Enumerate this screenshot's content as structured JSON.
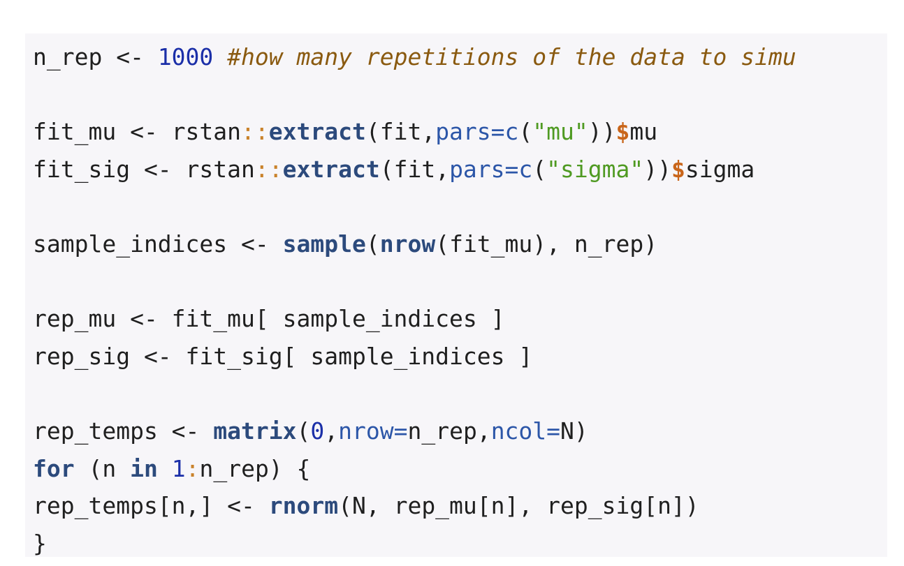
{
  "code": {
    "lines": [
      [
        {
          "text": "n_rep <- ",
          "kind": "plain"
        },
        {
          "text": "1000",
          "kind": "num"
        },
        {
          "text": " ",
          "kind": "plain"
        },
        {
          "text": "#how many repetitions of the data to simu",
          "kind": "comment"
        }
      ],
      [],
      [
        {
          "text": "fit_mu <- rstan",
          "kind": "plain"
        },
        {
          "text": "::",
          "kind": "op"
        },
        {
          "text": "extract",
          "kind": "fn"
        },
        {
          "text": "(fit,",
          "kind": "plain"
        },
        {
          "text": "pars=",
          "kind": "arg"
        },
        {
          "text": "c",
          "kind": "arg"
        },
        {
          "text": "(",
          "kind": "plain"
        },
        {
          "text": "\"mu\"",
          "kind": "str"
        },
        {
          "text": "))",
          "kind": "plain"
        },
        {
          "text": "$",
          "kind": "dollar"
        },
        {
          "text": "mu",
          "kind": "plain"
        }
      ],
      [
        {
          "text": "fit_sig <- rstan",
          "kind": "plain"
        },
        {
          "text": "::",
          "kind": "op"
        },
        {
          "text": "extract",
          "kind": "fn"
        },
        {
          "text": "(fit,",
          "kind": "plain"
        },
        {
          "text": "pars=",
          "kind": "arg"
        },
        {
          "text": "c",
          "kind": "arg"
        },
        {
          "text": "(",
          "kind": "plain"
        },
        {
          "text": "\"sigma\"",
          "kind": "str"
        },
        {
          "text": "))",
          "kind": "plain"
        },
        {
          "text": "$",
          "kind": "dollar"
        },
        {
          "text": "sigma",
          "kind": "plain"
        }
      ],
      [],
      [
        {
          "text": "sample_indices <- ",
          "kind": "plain"
        },
        {
          "text": "sample",
          "kind": "fn"
        },
        {
          "text": "(",
          "kind": "plain"
        },
        {
          "text": "nrow",
          "kind": "fn"
        },
        {
          "text": "(fit_mu), n_rep)",
          "kind": "plain"
        }
      ],
      [],
      [
        {
          "text": "rep_mu <- fit_mu[ sample_indices ]",
          "kind": "plain"
        }
      ],
      [
        {
          "text": "rep_sig <- fit_sig[ sample_indices ]",
          "kind": "plain"
        }
      ],
      [],
      [
        {
          "text": "rep_temps <- ",
          "kind": "plain"
        },
        {
          "text": "matrix",
          "kind": "fn"
        },
        {
          "text": "(",
          "kind": "plain"
        },
        {
          "text": "0",
          "kind": "num"
        },
        {
          "text": ",",
          "kind": "plain"
        },
        {
          "text": "nrow=",
          "kind": "arg"
        },
        {
          "text": "n_rep,",
          "kind": "plain"
        },
        {
          "text": "ncol=",
          "kind": "arg"
        },
        {
          "text": "N)",
          "kind": "plain"
        }
      ],
      [
        {
          "text": "for",
          "kind": "kw"
        },
        {
          "text": " (n ",
          "kind": "plain"
        },
        {
          "text": "in",
          "kind": "kw"
        },
        {
          "text": " ",
          "kind": "plain"
        },
        {
          "text": "1",
          "kind": "num"
        },
        {
          "text": ":",
          "kind": "colon"
        },
        {
          "text": "n_rep) {",
          "kind": "plain"
        }
      ],
      [
        {
          "text": "rep_temps[n,] <- ",
          "kind": "plain"
        },
        {
          "text": "rnorm",
          "kind": "fn"
        },
        {
          "text": "(N, rep_mu[n], rep_sig[n])",
          "kind": "plain"
        }
      ],
      [
        {
          "text": "}",
          "kind": "plain"
        }
      ]
    ]
  }
}
